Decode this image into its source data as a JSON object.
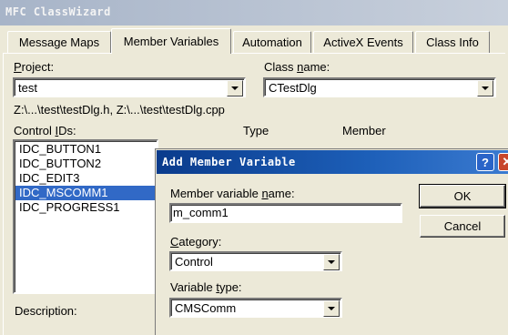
{
  "window": {
    "title": "MFC ClassWizard"
  },
  "tabs": [
    {
      "label": "Message Maps"
    },
    {
      "label": "Member Variables"
    },
    {
      "label": "Automation"
    },
    {
      "label": "ActiveX Events"
    },
    {
      "label": "Class Info"
    }
  ],
  "project": {
    "label_u": "P",
    "label_rest": "roject:",
    "value": "test"
  },
  "class_name": {
    "label_pre": "Class ",
    "label_u": "n",
    "label_rest": "ame:",
    "value": "CTestDlg"
  },
  "file_path": "Z:\\...\\test\\testDlg.h, Z:\\...\\test\\testDlg.cpp",
  "list_headers": {
    "control_ids_pre": "Control ",
    "control_ids_u": "I",
    "control_ids_rest": "Ds:",
    "type": "Type",
    "member": "Member"
  },
  "control_ids": [
    "IDC_BUTTON1",
    "IDC_BUTTON2",
    "IDC_EDIT3",
    "IDC_MSCOMM1",
    "IDC_PROGRESS1"
  ],
  "selected_control": "IDC_MSCOMM1",
  "description_label": "Description:",
  "dialog": {
    "title": "Add Member Variable",
    "help_glyph": "?",
    "close_glyph": "✕",
    "member_name_label_pre": "Member variable ",
    "member_name_label_u": "n",
    "member_name_label_rest": "ame:",
    "member_name_value": "m_comm1",
    "category_label_u": "C",
    "category_label_rest": "ategory:",
    "category_value": "Control",
    "variable_type_label_pre": "Variable ",
    "variable_type_label_u": "t",
    "variable_type_label_rest": "ype:",
    "variable_type_value": "CMSComm",
    "ok_label": "OK",
    "cancel_label": "Cancel"
  }
}
